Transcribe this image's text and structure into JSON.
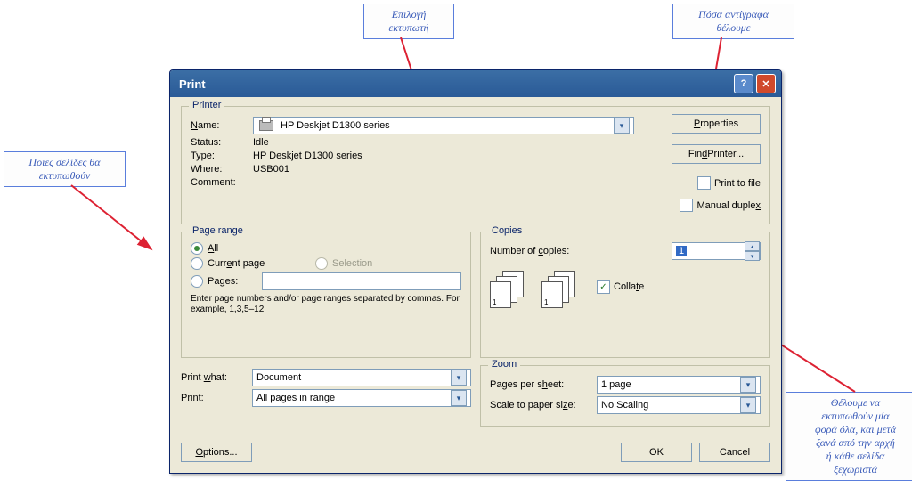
{
  "callouts": {
    "printerSel": "Επιλογή\nεκτυπωτή",
    "copies": "Πόσα αντίγραφα\nθέλουμε",
    "pages": "Ποιες σελίδες θα\nεκτυπωθούν",
    "collate": "Θέλουμε να\nεκτυπωθούν μία\nφορά όλα, και μετά\nξανά από την αρχή\nή κάθε σελίδα\nξεχωριστά"
  },
  "dialog": {
    "title": "Print",
    "printer": {
      "legend": "Printer",
      "nameLabel": "Name:",
      "nameValue": "HP Deskjet D1300 series",
      "statusLabel": "Status:",
      "statusValue": "Idle",
      "typeLabel": "Type:",
      "typeValue": "HP Deskjet D1300 series",
      "whereLabel": "Where:",
      "whereValue": "USB001",
      "commentLabel": "Comment:",
      "propertiesBtn": "Properties",
      "findPrinterBtn": "Find Printer...",
      "printToFile": "Print to file",
      "manualDuplex": "Manual duplex"
    },
    "pageRange": {
      "legend": "Page range",
      "all": "All",
      "current": "Current page",
      "selection": "Selection",
      "pages": "Pages:",
      "hint": "Enter page numbers and/or page ranges separated by commas.  For example, 1,3,5–12"
    },
    "copies": {
      "legend": "Copies",
      "numLabel": "Number of copies:",
      "numValue": "1",
      "collate": "Collate"
    },
    "printWhat": {
      "label": "Print what:",
      "value": "Document"
    },
    "print": {
      "label": "Print:",
      "value": "All pages in range"
    },
    "zoom": {
      "legend": "Zoom",
      "ppsLabel": "Pages per sheet:",
      "ppsValue": "1 page",
      "scaleLabel": "Scale to paper size:",
      "scaleValue": "No Scaling"
    },
    "buttons": {
      "options": "Options...",
      "ok": "OK",
      "cancel": "Cancel"
    }
  }
}
